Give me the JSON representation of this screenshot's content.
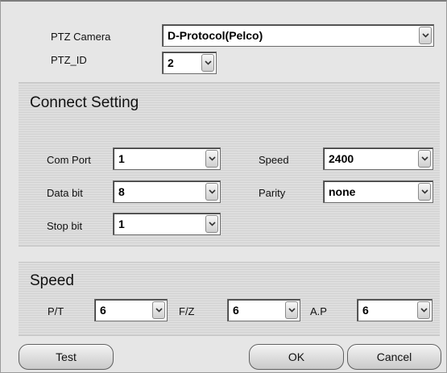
{
  "camera": {
    "ptz_camera_label": "PTZ Camera",
    "ptz_camera_value": "D-Protocol(Pelco)",
    "ptz_id_label": "PTZ_ID",
    "ptz_id_value": "2"
  },
  "connect": {
    "title": "Connect Setting",
    "com_port_label": "Com Port",
    "com_port_value": "1",
    "speed_label": "Speed",
    "speed_value": "2400",
    "data_bit_label": "Data bit",
    "data_bit_value": "8",
    "parity_label": "Parity",
    "parity_value": "none",
    "stop_bit_label": "Stop bit",
    "stop_bit_value": "1"
  },
  "speed": {
    "title": "Speed",
    "pt_label": "P/T",
    "pt_value": "6",
    "fz_label": "F/Z",
    "fz_value": "6",
    "ap_label": "A.P",
    "ap_value": "6"
  },
  "buttons": {
    "test": "Test",
    "ok": "OK",
    "cancel": "Cancel"
  },
  "icons": {
    "dropdown": "chevron-down-icon"
  }
}
